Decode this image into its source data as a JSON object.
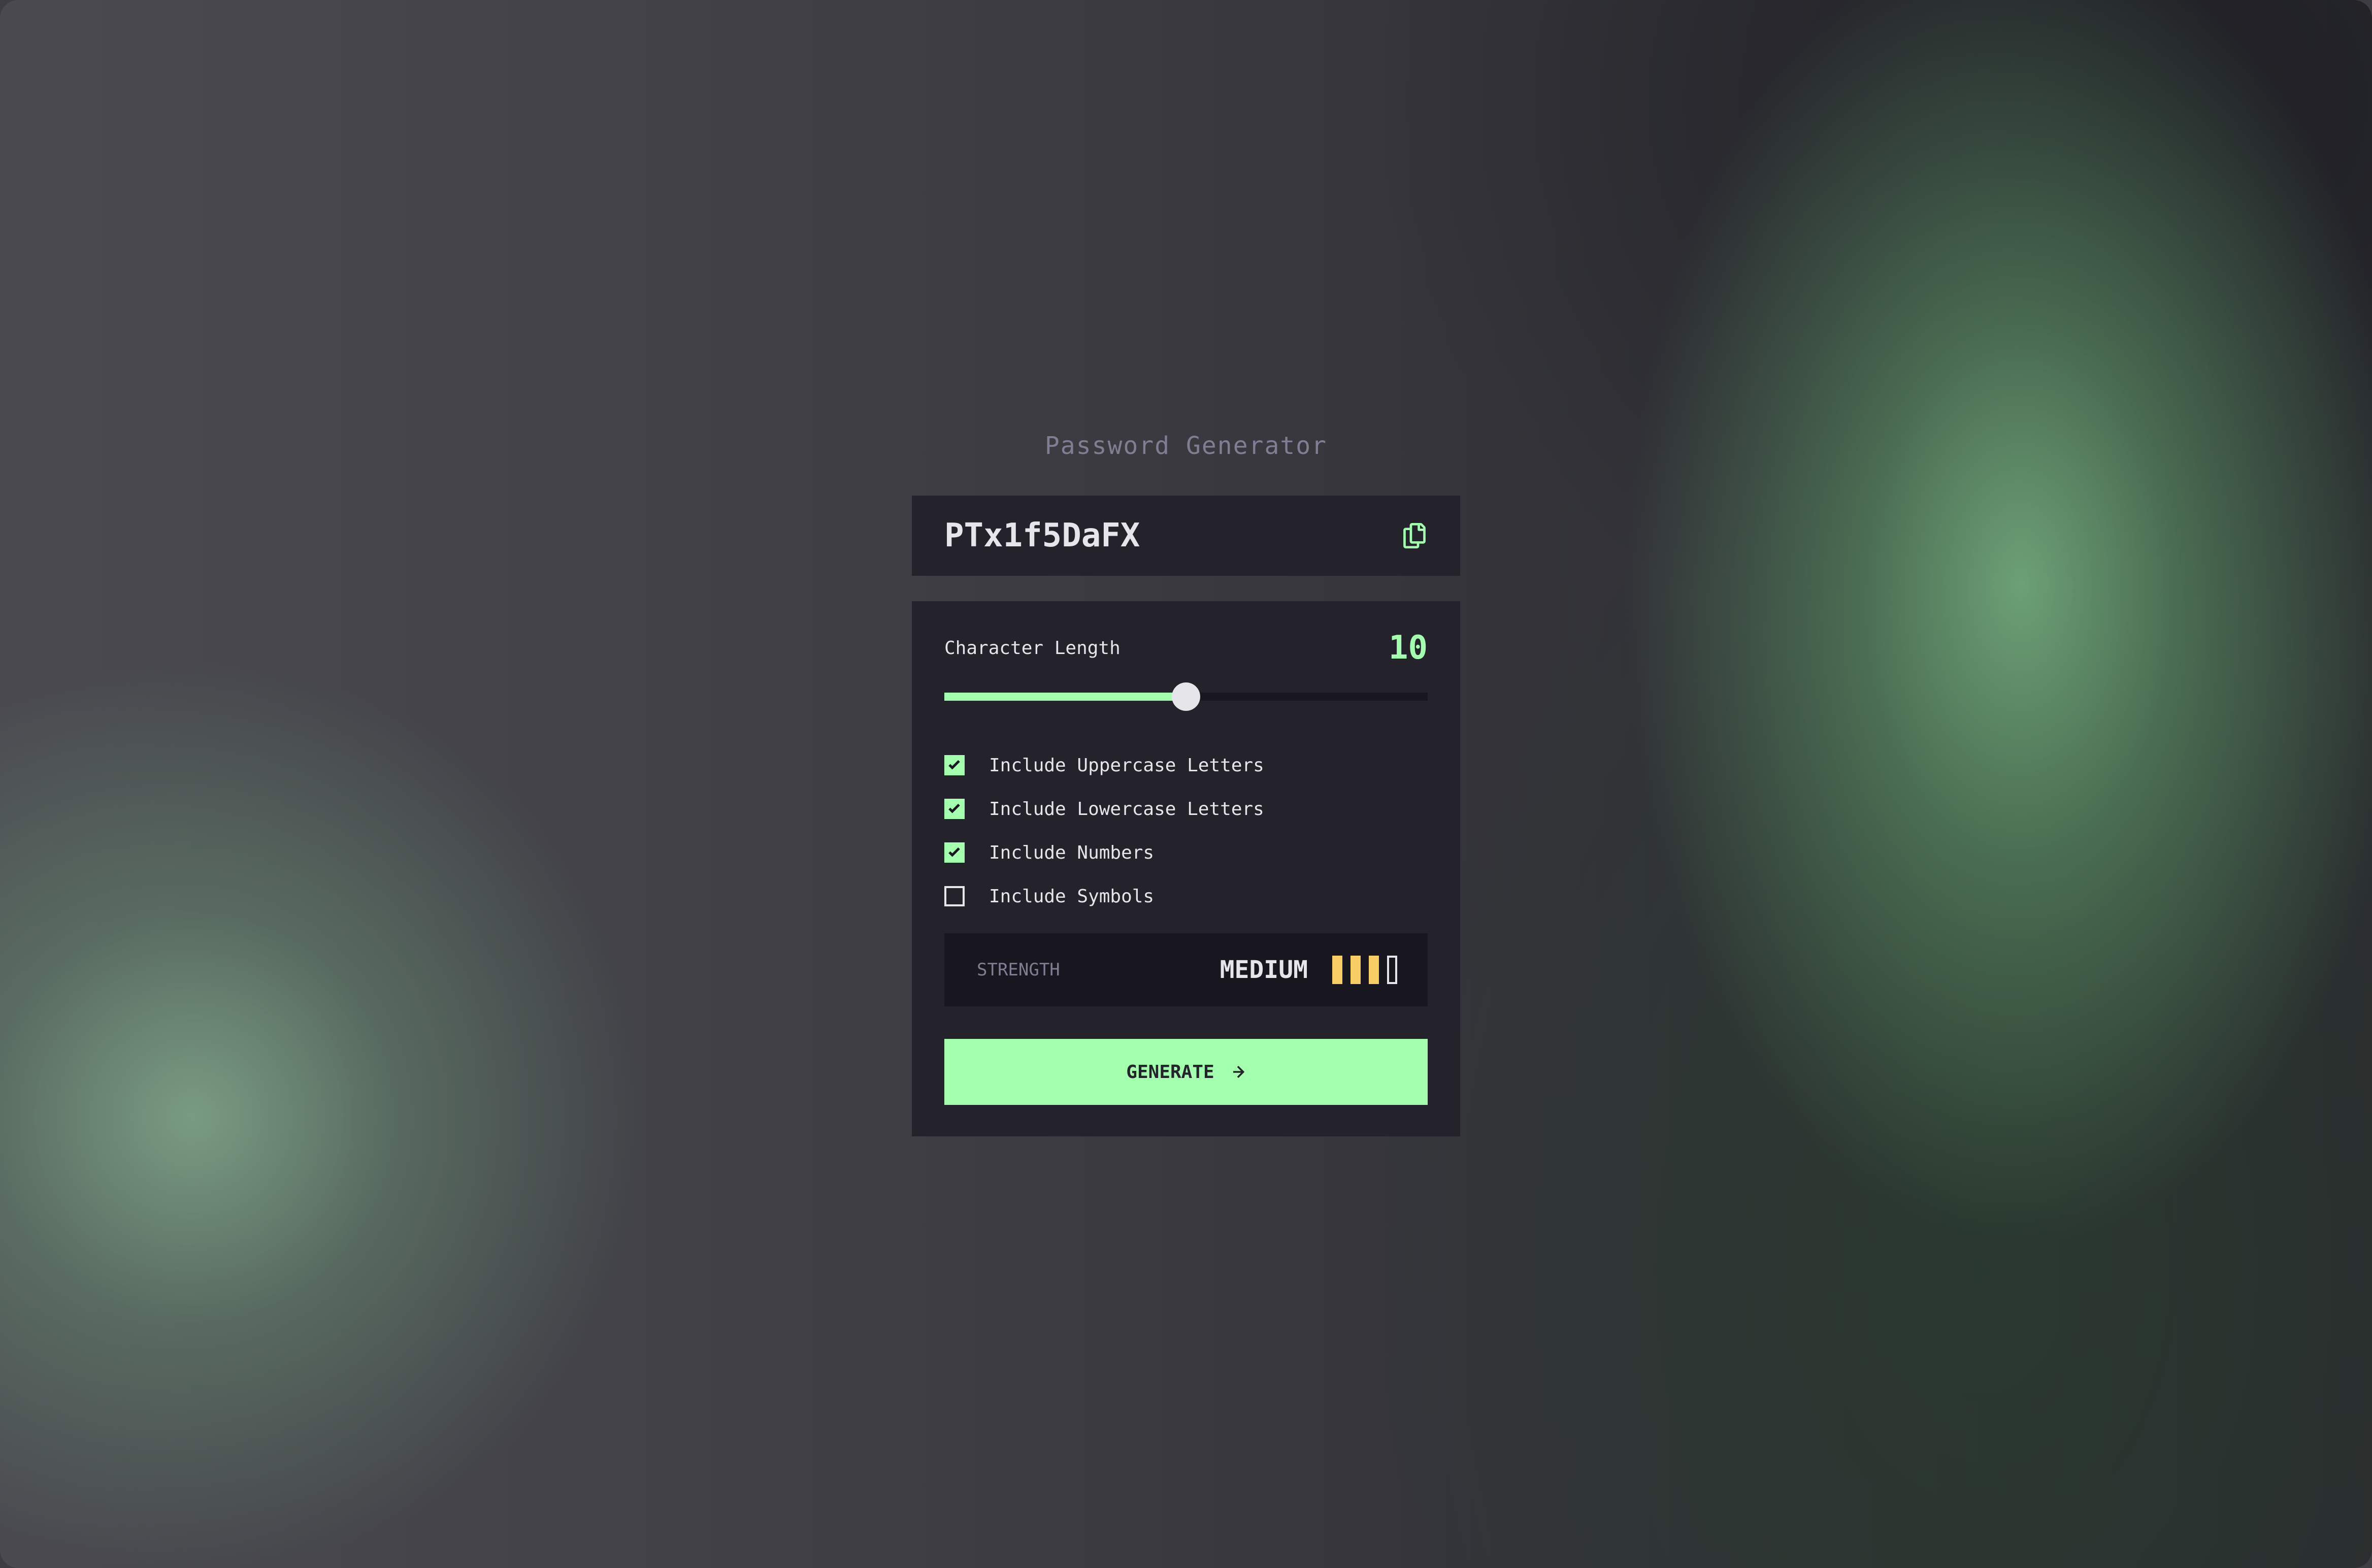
{
  "app": {
    "title": "Password Generator"
  },
  "password": {
    "value": "PTx1f5DaFX",
    "copy_icon": "copy-icon"
  },
  "length": {
    "label": "Character Length",
    "value": "10",
    "slider_fraction": 0.5
  },
  "options": [
    {
      "label": "Include Uppercase Letters",
      "checked": true
    },
    {
      "label": "Include Lowercase Letters",
      "checked": true
    },
    {
      "label": "Include Numbers",
      "checked": true
    },
    {
      "label": "Include Symbols",
      "checked": false
    }
  ],
  "strength": {
    "label": "STRENGTH",
    "value": "MEDIUM",
    "bars_filled": 3,
    "bars_total": 4
  },
  "generate": {
    "label": "GENERATE",
    "icon": "arrow-right-icon"
  },
  "colors": {
    "accent": "#a4ffaf",
    "panel": "#24232b",
    "medium": "#f8cd65",
    "muted": "#817d92",
    "text": "#e6e5ea"
  }
}
